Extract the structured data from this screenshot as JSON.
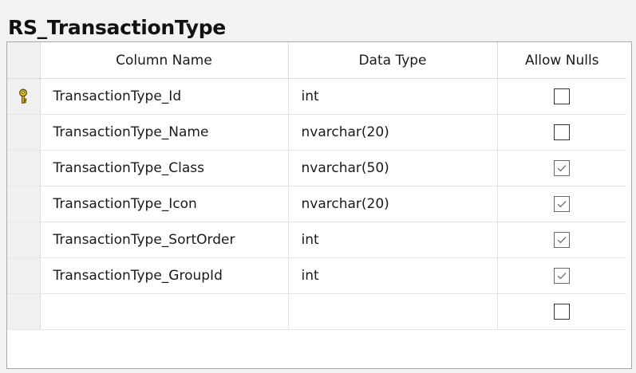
{
  "title": "RS_TransactionType",
  "headers": {
    "column_name": "Column Name",
    "data_type": "Data Type",
    "allow_nulls": "Allow Nulls"
  },
  "rows": [
    {
      "name": "TransactionType_Id",
      "type": "int",
      "allow_nulls": false,
      "primary_key": true
    },
    {
      "name": "TransactionType_Name",
      "type": "nvarchar(20)",
      "allow_nulls": false,
      "primary_key": false
    },
    {
      "name": "TransactionType_Class",
      "type": "nvarchar(50)",
      "allow_nulls": true,
      "primary_key": false
    },
    {
      "name": "TransactionType_Icon",
      "type": "nvarchar(20)",
      "allow_nulls": true,
      "primary_key": false
    },
    {
      "name": "TransactionType_SortOrder",
      "type": "int",
      "allow_nulls": true,
      "primary_key": false
    },
    {
      "name": "TransactionType_GroupId",
      "type": "int",
      "allow_nulls": true,
      "primary_key": false
    },
    {
      "name": "",
      "type": "",
      "allow_nulls": false,
      "primary_key": false
    }
  ],
  "icons": {
    "primary_key": "key-icon",
    "checkbox_checked": "checkmark-icon"
  },
  "colors": {
    "key_gold": "#e8c21a",
    "selector_bg": "#f0f0f0",
    "grid_border": "#a9a9a9"
  }
}
